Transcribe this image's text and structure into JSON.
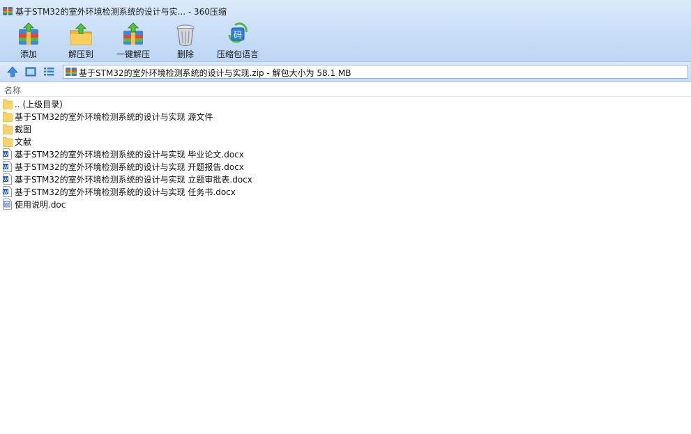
{
  "window": {
    "title": "基于STM32的室外环境检测系统的设计与实... - 360压缩"
  },
  "toolbar": {
    "buttons": [
      {
        "label": "添加",
        "icon": "add-archive-icon"
      },
      {
        "label": "解压到",
        "icon": "extract-to-icon"
      },
      {
        "label": "一键解压",
        "icon": "one-click-extract-icon"
      },
      {
        "label": "删除",
        "icon": "delete-trash-icon"
      },
      {
        "label": "压缩包语言",
        "icon": "archive-language-icon"
      }
    ]
  },
  "navbar": {
    "address": "基于STM32的室外环境检测系统的设计与实现.zip - 解包大小为 58.1 MB"
  },
  "list": {
    "column_name": "名称",
    "items": [
      {
        "name": ".. (上级目录)",
        "type": "folder"
      },
      {
        "name": "基于STM32的室外环境检测系统的设计与实现 源文件",
        "type": "folder"
      },
      {
        "name": "截图",
        "type": "folder"
      },
      {
        "name": "文献",
        "type": "folder"
      },
      {
        "name": "基于STM32的室外环境检测系统的设计与实现 毕业论文.docx",
        "type": "docx"
      },
      {
        "name": "基于STM32的室外环境检测系统的设计与实现 开题报告.docx",
        "type": "docx"
      },
      {
        "name": "基于STM32的室外环境检测系统的设计与实现 立题审批表.docx",
        "type": "docx"
      },
      {
        "name": "基于STM32的室外环境检测系统的设计与实现 任务书.docx",
        "type": "docx"
      },
      {
        "name": "使用说明.doc",
        "type": "doc"
      }
    ]
  },
  "colors": {
    "toolbar_bg": "#cfe2f8",
    "folder": "#f7d36b",
    "word_blue": "#2b5fb8"
  }
}
